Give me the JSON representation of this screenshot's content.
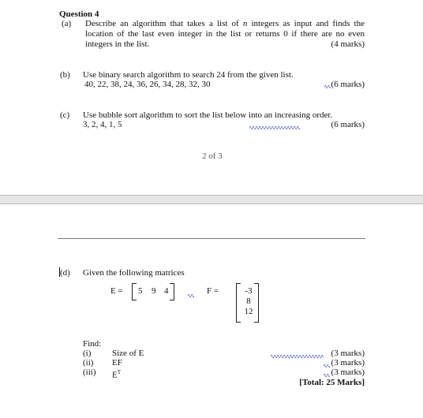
{
  "page1": {
    "question_title": "Question 4",
    "a": {
      "label": "(a)",
      "lines": [
        "Describe an algorithm that takes a list of",
        "n",
        "integers as input and finds the",
        "location of the last even integer in the list or returns 0 if there are no even",
        "integers in the list."
      ],
      "marks": "(4 marks)"
    },
    "b": {
      "label": "(b)",
      "text": "Use binary search algorithm to search 24 from the given list.",
      "list": "40, 22, 38, 24, 36, 26, 34, 28, 32, 30",
      "marks": "(6 marks)"
    },
    "c": {
      "label": "(c)",
      "text": "Use bubble sort algorithm to sort the list below into an increasing order.",
      "list": "3, 2, 4, 1, 5",
      "marks": "(6 marks)"
    },
    "page_number": "2 of 3"
  },
  "page2": {
    "d": {
      "label": "(d)",
      "text": "Given the following matrices",
      "matrix_e": {
        "label": "E =",
        "values": [
          "5",
          "9",
          "4"
        ]
      },
      "matrix_f": {
        "label": "F =",
        "values": [
          "-3",
          "8",
          "12"
        ]
      },
      "find_label": "Find:",
      "parts": [
        {
          "label": "(i)",
          "text": "Size of E",
          "marks": "(3 marks)"
        },
        {
          "label": "(ii)",
          "text": "EF",
          "marks": "(3 marks)"
        },
        {
          "label": "(iii)",
          "text": "E",
          "superscript": "T",
          "marks": "(3 marks)"
        }
      ],
      "total": "[Total: 25 Marks]"
    }
  },
  "colors": {
    "spellcheck_squiggle": "#3344cc",
    "page_break_band": "#e6e6e6",
    "separator": "#7a7a7a"
  }
}
